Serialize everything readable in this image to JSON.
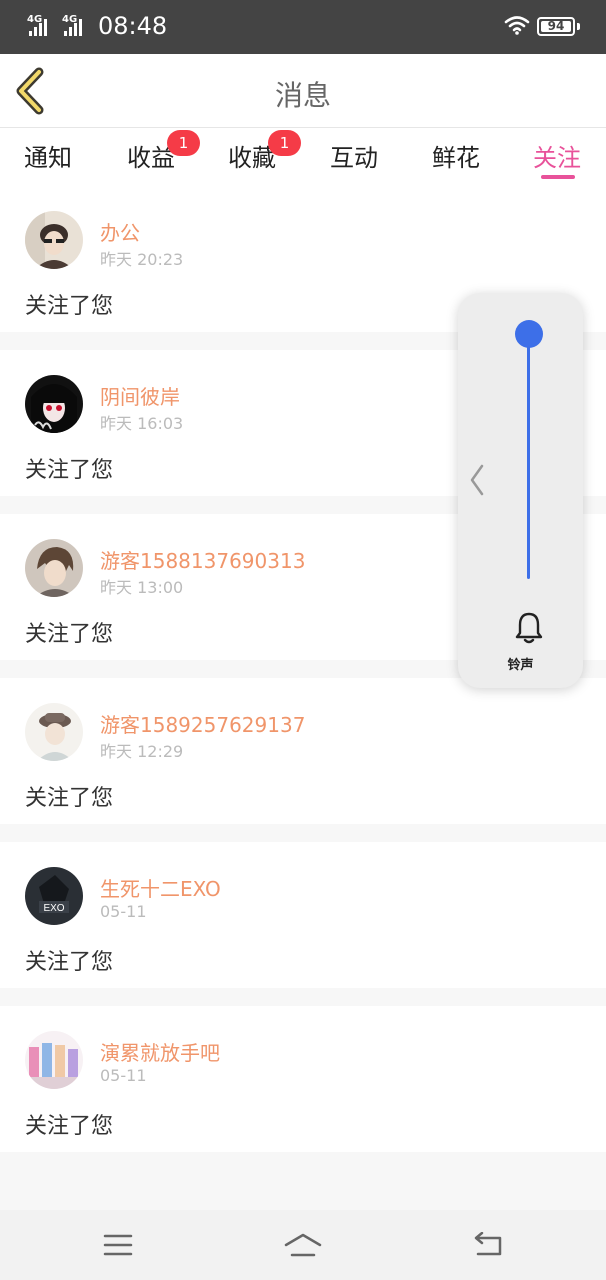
{
  "status_bar": {
    "network_1": "4G",
    "network_2": "4G",
    "time": "08:48",
    "battery": "94",
    "icons": [
      "signal-icon",
      "wifi-icon",
      "battery-icon"
    ]
  },
  "header": {
    "title": "消息",
    "back_icon": "chevron-left-icon"
  },
  "tabs": [
    {
      "label": "通知",
      "badge": ""
    },
    {
      "label": "收益",
      "badge": "1"
    },
    {
      "label": "收藏",
      "badge": "1"
    },
    {
      "label": "互动",
      "badge": ""
    },
    {
      "label": "鲜花",
      "badge": ""
    },
    {
      "label": "关注",
      "badge": "",
      "active": true
    }
  ],
  "messages": [
    {
      "username": "办公",
      "time": "昨天 20:23",
      "action": "关注了您"
    },
    {
      "username": "阴间彼岸",
      "time": "昨天 16:03",
      "action": "关注了您"
    },
    {
      "username": "游客1588137690313",
      "time": "昨天 13:00",
      "action": "关注了您"
    },
    {
      "username": "游客1589257629137",
      "time": "昨天 12:29",
      "action": "关注了您"
    },
    {
      "username": "生死十二EXO",
      "time": "05-11",
      "action": "关注了您"
    },
    {
      "username": "演累就放手吧",
      "time": "05-11",
      "action": "关注了您"
    }
  ],
  "volume_panel": {
    "label": "铃声",
    "level": 1.0,
    "icon": "bell-icon"
  },
  "navbar": {
    "icons": [
      "menu-icon",
      "home-icon",
      "back-icon"
    ]
  },
  "colors": {
    "accent": "#e8529a",
    "username": "#f0956a",
    "badge": "#f53b47",
    "slider": "#3d6fe8",
    "status_bar": "#444444"
  }
}
